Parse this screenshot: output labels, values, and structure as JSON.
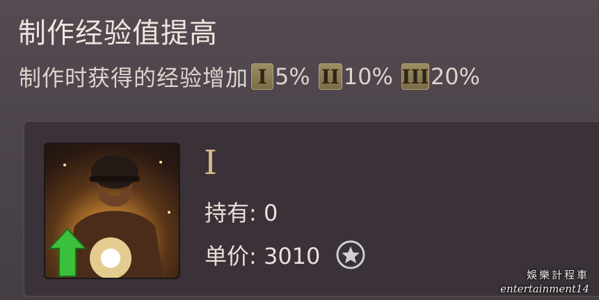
{
  "skill": {
    "title": "制作经验值提高",
    "description": "制作时获得的经验增加",
    "tiers": [
      {
        "badge": "I",
        "value": "5%"
      },
      {
        "badge": "II",
        "value": "10%"
      },
      {
        "badge": "III",
        "value": "20%"
      }
    ]
  },
  "item": {
    "icon": "soldier-exp-boost-icon",
    "tier": "I",
    "held": "持有: 0",
    "price": "单价: 3010",
    "currency_icon": "star-coin-icon"
  },
  "watermark": {
    "text_cn": "娛樂計程車",
    "text_en": "entertainment14"
  }
}
